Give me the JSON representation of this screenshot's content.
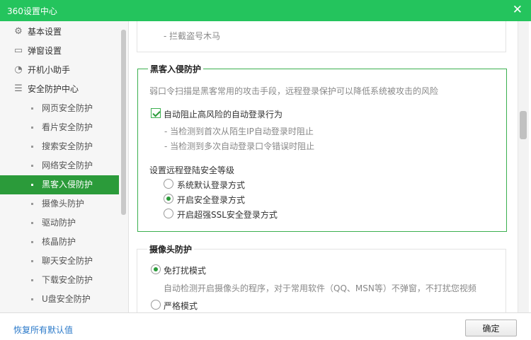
{
  "window": {
    "title": "360设置中心",
    "close_glyph": "✕"
  },
  "sidebar": {
    "items": [
      {
        "label": "基本设置",
        "icon": "gear-icon",
        "glyph": "⚙"
      },
      {
        "label": "弹窗设置",
        "icon": "window-icon",
        "glyph": "▭"
      },
      {
        "label": "开机小助手",
        "icon": "stopwatch-icon",
        "glyph": "◔"
      },
      {
        "label": "安全防护中心",
        "icon": "list-icon",
        "glyph": "☰"
      }
    ],
    "sub_items": [
      {
        "label": "网页安全防护"
      },
      {
        "label": "看片安全防护"
      },
      {
        "label": "搜索安全防护"
      },
      {
        "label": "网络安全防护"
      },
      {
        "label": "黑客入侵防护",
        "active": true
      },
      {
        "label": "摄像头防护"
      },
      {
        "label": "驱动防护"
      },
      {
        "label": "核晶防护"
      },
      {
        "label": "聊天安全防护"
      },
      {
        "label": "下载安全防护"
      },
      {
        "label": "U盘安全防护"
      }
    ]
  },
  "prev_section": {
    "item": "- 拦截盗号木马"
  },
  "hacker": {
    "title": "黑客入侵防护",
    "description": "弱口令扫描是黑客常用的攻击手段，远程登录保护可以降低系统被攻击的风险",
    "auto_block": {
      "label": "自动阻止高风险的自动登录行为",
      "checked": true
    },
    "notes": [
      "- 当检测到首次从陌生IP自动登录时阻止",
      "- 当检测到多次自动登录口令错误时阻止"
    ],
    "level_title": "设置远程登陆安全等级",
    "options": [
      {
        "label": "系统默认登录方式",
        "selected": false
      },
      {
        "label": "开启安全登录方式",
        "selected": true
      },
      {
        "label": "开启超强SSL安全登录方式",
        "selected": false
      }
    ]
  },
  "camera": {
    "title": "摄像头防护",
    "mode1": {
      "label": "免打扰模式",
      "selected": true
    },
    "mode1_desc": "自动检测开启摄像头的程序，对于常用软件（QQ、MSN等）不弹窗，不打扰您视频",
    "mode2": {
      "label": "严格模式",
      "selected": false
    }
  },
  "footer": {
    "restore_label": "恢复所有默认值",
    "ok_label": "确定"
  }
}
